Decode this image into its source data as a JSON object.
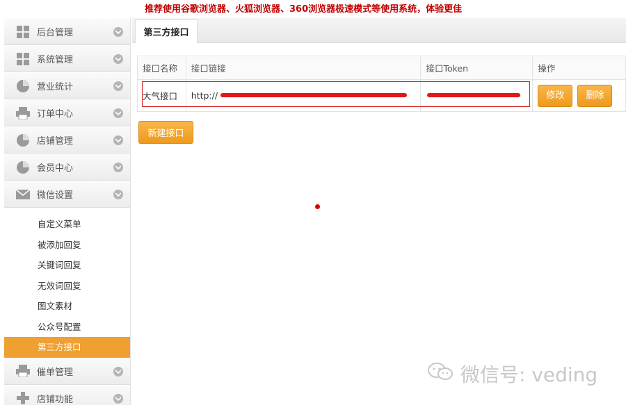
{
  "notice": "推荐使用谷歌浏览器、火狐浏览器、360浏览器极速模式等使用系统，体验更佳",
  "sidebar": {
    "menu_top": [
      {
        "label": "后台管理",
        "icon": "grid-icon"
      },
      {
        "label": "系统管理",
        "icon": "grid-icon"
      },
      {
        "label": "营业统计",
        "icon": "pie-chart-icon"
      },
      {
        "label": "订单中心",
        "icon": "printer-icon"
      },
      {
        "label": "店铺管理",
        "icon": "pie-chart-icon"
      },
      {
        "label": "会员中心",
        "icon": "pie-chart-icon"
      },
      {
        "label": "微信设置",
        "icon": "envelope-icon"
      }
    ],
    "sub_items": [
      {
        "label": "自定义菜单"
      },
      {
        "label": "被添加回复"
      },
      {
        "label": "关键词回复"
      },
      {
        "label": "无效词回复"
      },
      {
        "label": "图文素材"
      },
      {
        "label": "公众号配置"
      },
      {
        "label": "第三方接口",
        "active": true
      }
    ],
    "menu_bottom": [
      {
        "label": "催单管理",
        "icon": "printer-icon"
      },
      {
        "label": "店铺功能",
        "icon": "plus-icon"
      }
    ]
  },
  "tab": {
    "label": "第三方接口"
  },
  "table": {
    "headers": [
      "接口名称",
      "接口链接",
      "接口Token",
      "操作"
    ],
    "rows": [
      {
        "name": "大气接口",
        "url": "http://",
        "token": "",
        "edit": "修改",
        "delete": "删除"
      }
    ]
  },
  "new_button": "新建接口",
  "watermark": "微信号: veding",
  "colors": {
    "accent": "#f0a030",
    "notice": "#c00000",
    "redact": "#e01818"
  }
}
